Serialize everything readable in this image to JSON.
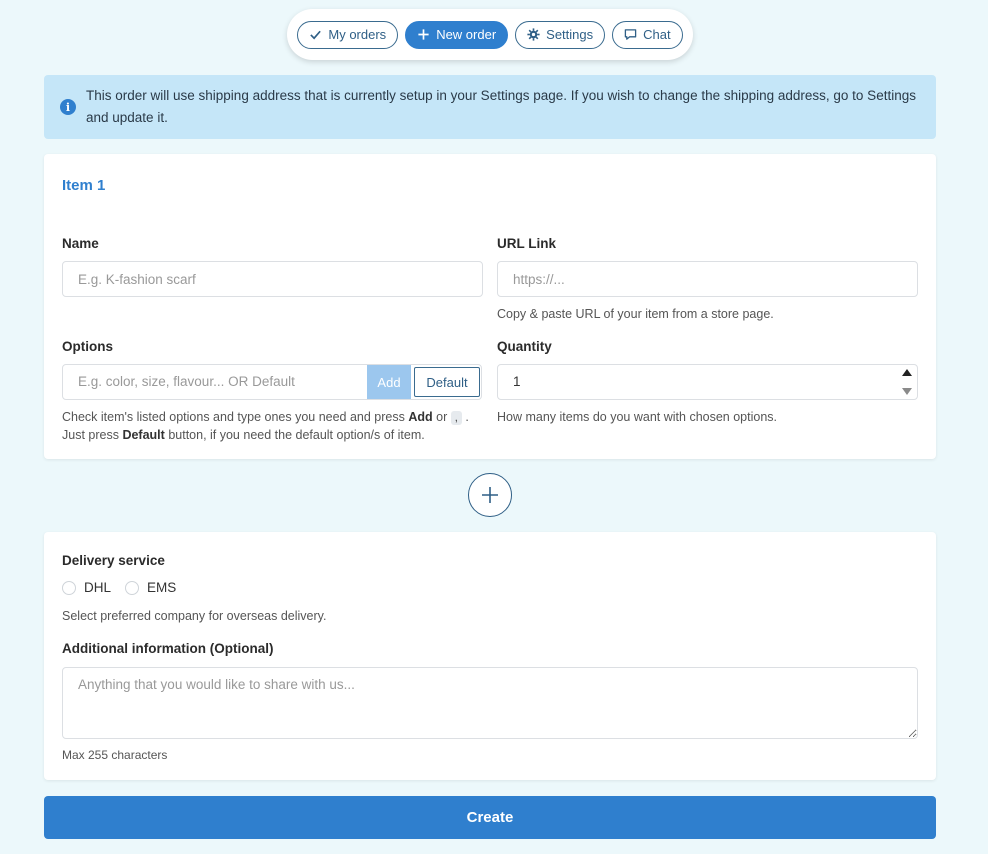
{
  "nav": {
    "my_orders": "My orders",
    "new_order": "New order",
    "settings": "Settings",
    "chat": "Chat",
    "active": "New order"
  },
  "alert": {
    "icon": "info-icon",
    "message": "This order will use shipping address that is currently setup in your Settings page. If you wish to change the shipping address, go to Settings and update it."
  },
  "item": {
    "title": "Item 1",
    "name_label": "Name",
    "name_placeholder": "E.g. K-fashion scarf",
    "url_label": "URL Link",
    "url_placeholder": "https://...",
    "url_help": "Copy & paste URL of your item from a store page.",
    "options_label": "Options",
    "options_placeholder": "E.g. color, size, flavour... OR Default",
    "add_button": "Add",
    "default_button": "Default",
    "options_help_1": "Check item's listed options and type ones you need and press",
    "options_help_add": "Add",
    "options_help_or": "or",
    "options_help_comma": ",",
    "options_help_dot": ".",
    "options_help_2": "Just press",
    "options_help_default": "Default",
    "options_help_3": "button, if you need the default option/s of item.",
    "quantity_label": "Quantity",
    "quantity_value": "1",
    "quantity_help": "How many items do you want with chosen options."
  },
  "delivery": {
    "label": "Delivery service",
    "options": [
      "DHL",
      "EMS"
    ],
    "help": "Select preferred company for overseas delivery.",
    "additional_label": "Additional information (Optional)",
    "additional_placeholder": "Anything that you would like to share with us...",
    "max_chars": "Max 255 characters"
  },
  "create_button": "Create",
  "colors": {
    "background": "#ecf8fb",
    "primary": "#2f7fce",
    "alert_bg": "#c5e6f8"
  }
}
